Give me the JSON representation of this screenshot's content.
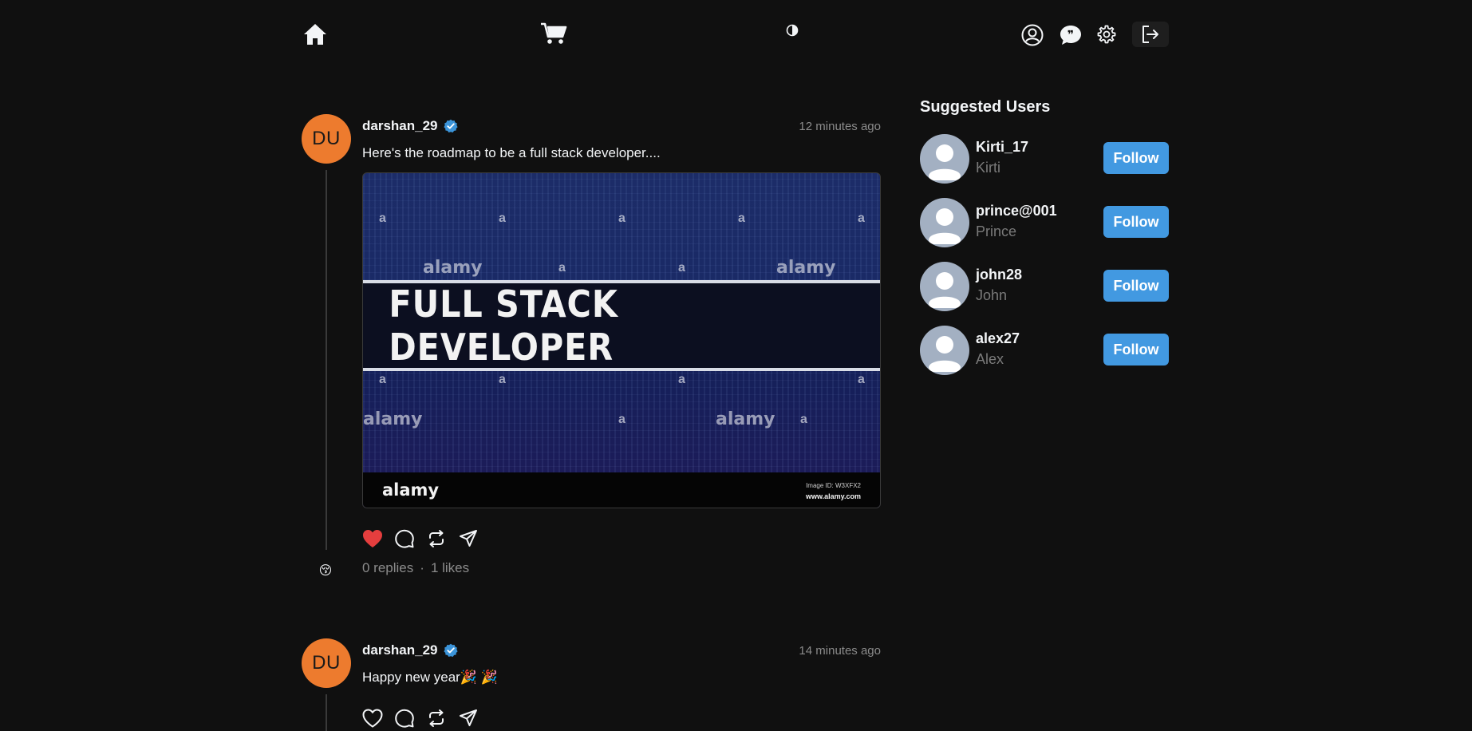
{
  "nav": {
    "home_icon": "home-icon",
    "cart_icon": "cart-icon",
    "theme_icon": "theme-toggle-icon",
    "profile_icon": "user-circle-icon",
    "chat_icon": "chat-icon",
    "settings_icon": "gear-icon",
    "logout_icon": "logout-icon"
  },
  "posts": [
    {
      "avatar_initials": "DU",
      "username": "darshan_29",
      "verified": true,
      "time": "12 minutes ago",
      "text": "Here's the roadmap to be a full stack developer....",
      "image": {
        "headline": "FULL STACK DEVELOPER",
        "watermark": "alamy",
        "watermark_letter": "a",
        "footer_brand": "alamy",
        "footer_id": "Image ID: W3XFX2",
        "footer_url": "www.alamy.com"
      },
      "liked": true,
      "replies": "0 replies",
      "separator": "·",
      "likes": "1 likes",
      "reply_emoji": "😚"
    },
    {
      "avatar_initials": "DU",
      "username": "darshan_29",
      "verified": true,
      "time": "14 minutes ago",
      "text": "Happy new year🎉 🎉",
      "liked": false
    }
  ],
  "sidebar": {
    "title": "Suggested Users",
    "users": [
      {
        "name": "Kirti_17",
        "handle": "Kirti",
        "button": "Follow"
      },
      {
        "name": "prince@001",
        "handle": "Prince",
        "button": "Follow"
      },
      {
        "name": "john28",
        "handle": "John",
        "button": "Follow"
      },
      {
        "name": "alex27",
        "handle": "Alex",
        "button": "Follow"
      }
    ]
  },
  "colors": {
    "background": "#101010",
    "avatar_orange": "#ed7b2e",
    "follow_blue": "#4299e1",
    "like_red": "#e53e3e",
    "verified_blue": "#3b94d9"
  }
}
